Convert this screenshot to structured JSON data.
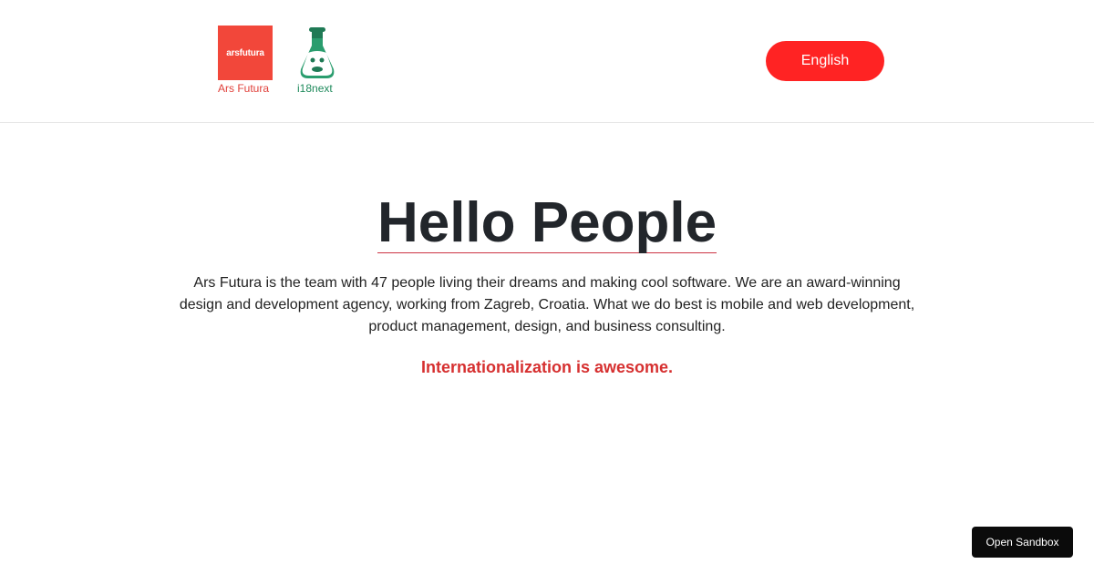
{
  "header": {
    "ars_logo_text": "arsfutura",
    "ars_caption": "Ars Futura",
    "i18next_caption": "i18next",
    "language_button": "English",
    "colors": {
      "ars_red": "#f2473a",
      "i18next_green": "#1f8a5c",
      "button_red": "#ff2323"
    }
  },
  "main": {
    "title": "Hello People",
    "description": "Ars Futura is the team with 47 people living their dreams and making cool software. We are an award-winning design and development agency, working from Zagreb, Croatia. What we do best is mobile and web development, product management, design, and business consulting.",
    "tagline": "Internationalization is awesome."
  },
  "footer": {
    "sandbox_button": "Open Sandbox"
  }
}
